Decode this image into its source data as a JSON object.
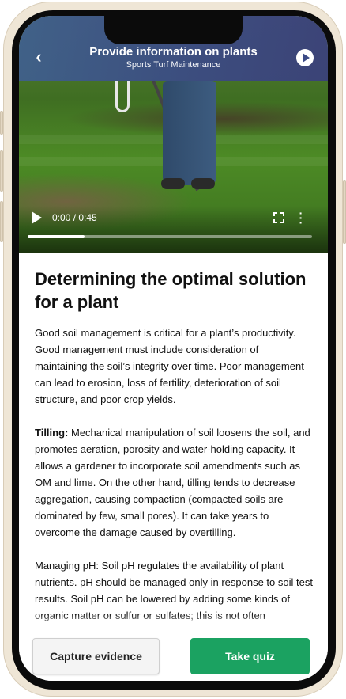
{
  "header": {
    "title": "Provide information on plants",
    "subtitle": "Sports Turf Maintenance"
  },
  "video": {
    "time": "0:00 / 0:45",
    "progress": 0.2
  },
  "icons": {
    "back": "chevron-left-icon",
    "play_header": "play-circle-icon",
    "play": "play-icon",
    "fullscreen": "fullscreen-icon",
    "more": "more-vertical-icon"
  },
  "article": {
    "heading": "Determining the optimal solution for a plant",
    "para1": "Good soil management is critical for a plant’s productivity. Good management must include consideration of maintaining the soil’s integrity over time. Poor management can lead to erosion, loss of fertility, deterioration of soil structure, and poor crop yields.",
    "para2_label": "Tilling:",
    "para2": " Mechanical manipulation of soil loosens the soil, and promotes aeration, porosity and water-holding capacity. It allows a gardener to incorporate soil amendments such as OM and lime. On the other hand, tilling tends to decrease aggregation, causing compaction (compacted soils are dominated by few, small pores). It can take years to overcome the damage caused by overtilling.",
    "para3": "Managing pH: Soil pH regulates the availability of plant nutrients. pH should be managed only in response to soil test results. Soil pH can be lowered by adding some kinds of organic matter or sulfur or sulfates; this is not often"
  },
  "actions": {
    "capture": "Capture evidence",
    "quiz": "Take quiz"
  },
  "colors": {
    "accent": "#1ba261",
    "header": "#3b4a86"
  }
}
